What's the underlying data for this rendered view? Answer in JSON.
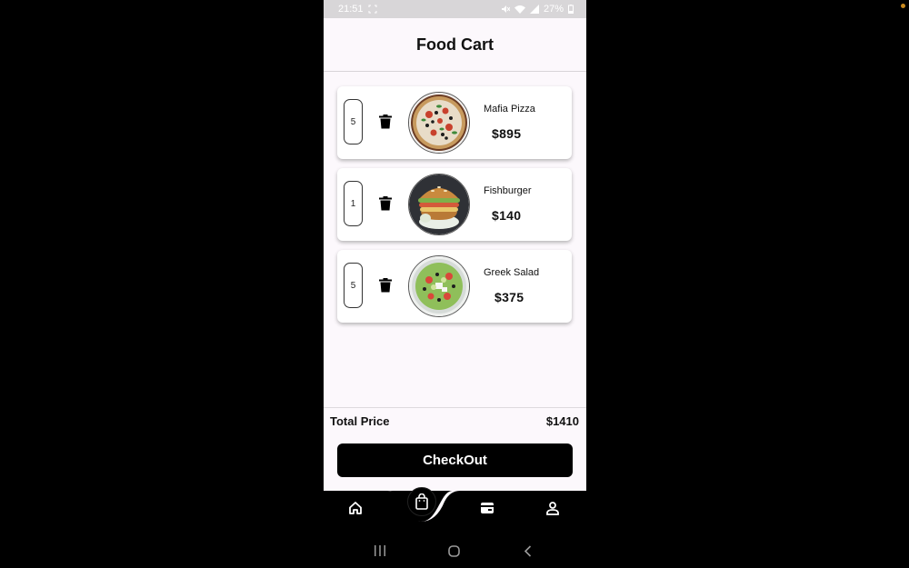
{
  "status_bar": {
    "time": "21:51",
    "battery": "27%"
  },
  "app": {
    "title": "Food Cart"
  },
  "cart": {
    "items": [
      {
        "quantity": "5",
        "name": "Mafia Pizza",
        "price": "$895",
        "image": "pizza-image"
      },
      {
        "quantity": "1",
        "name": "Fishburger",
        "price": "$140",
        "image": "burger-image"
      },
      {
        "quantity": "5",
        "name": "Greek Salad",
        "price": "$375",
        "image": "salad-image"
      }
    ]
  },
  "summary": {
    "total_label": "Total Price",
    "total_value": "$1410"
  },
  "checkout_label": "CheckOut",
  "bottom_nav": {
    "items": [
      {
        "icon": "home-icon"
      },
      {
        "icon": "shopping-bag-icon",
        "active": true
      },
      {
        "icon": "wallet-icon"
      },
      {
        "icon": "user-icon"
      }
    ]
  },
  "system_nav": {
    "items": [
      "recents-icon",
      "home-circle-icon",
      "back-icon"
    ]
  },
  "colors": {
    "background": "#fcf8fc",
    "accent": "#000000",
    "card": "#ffffff",
    "status_bar": "#d8d6d8"
  }
}
